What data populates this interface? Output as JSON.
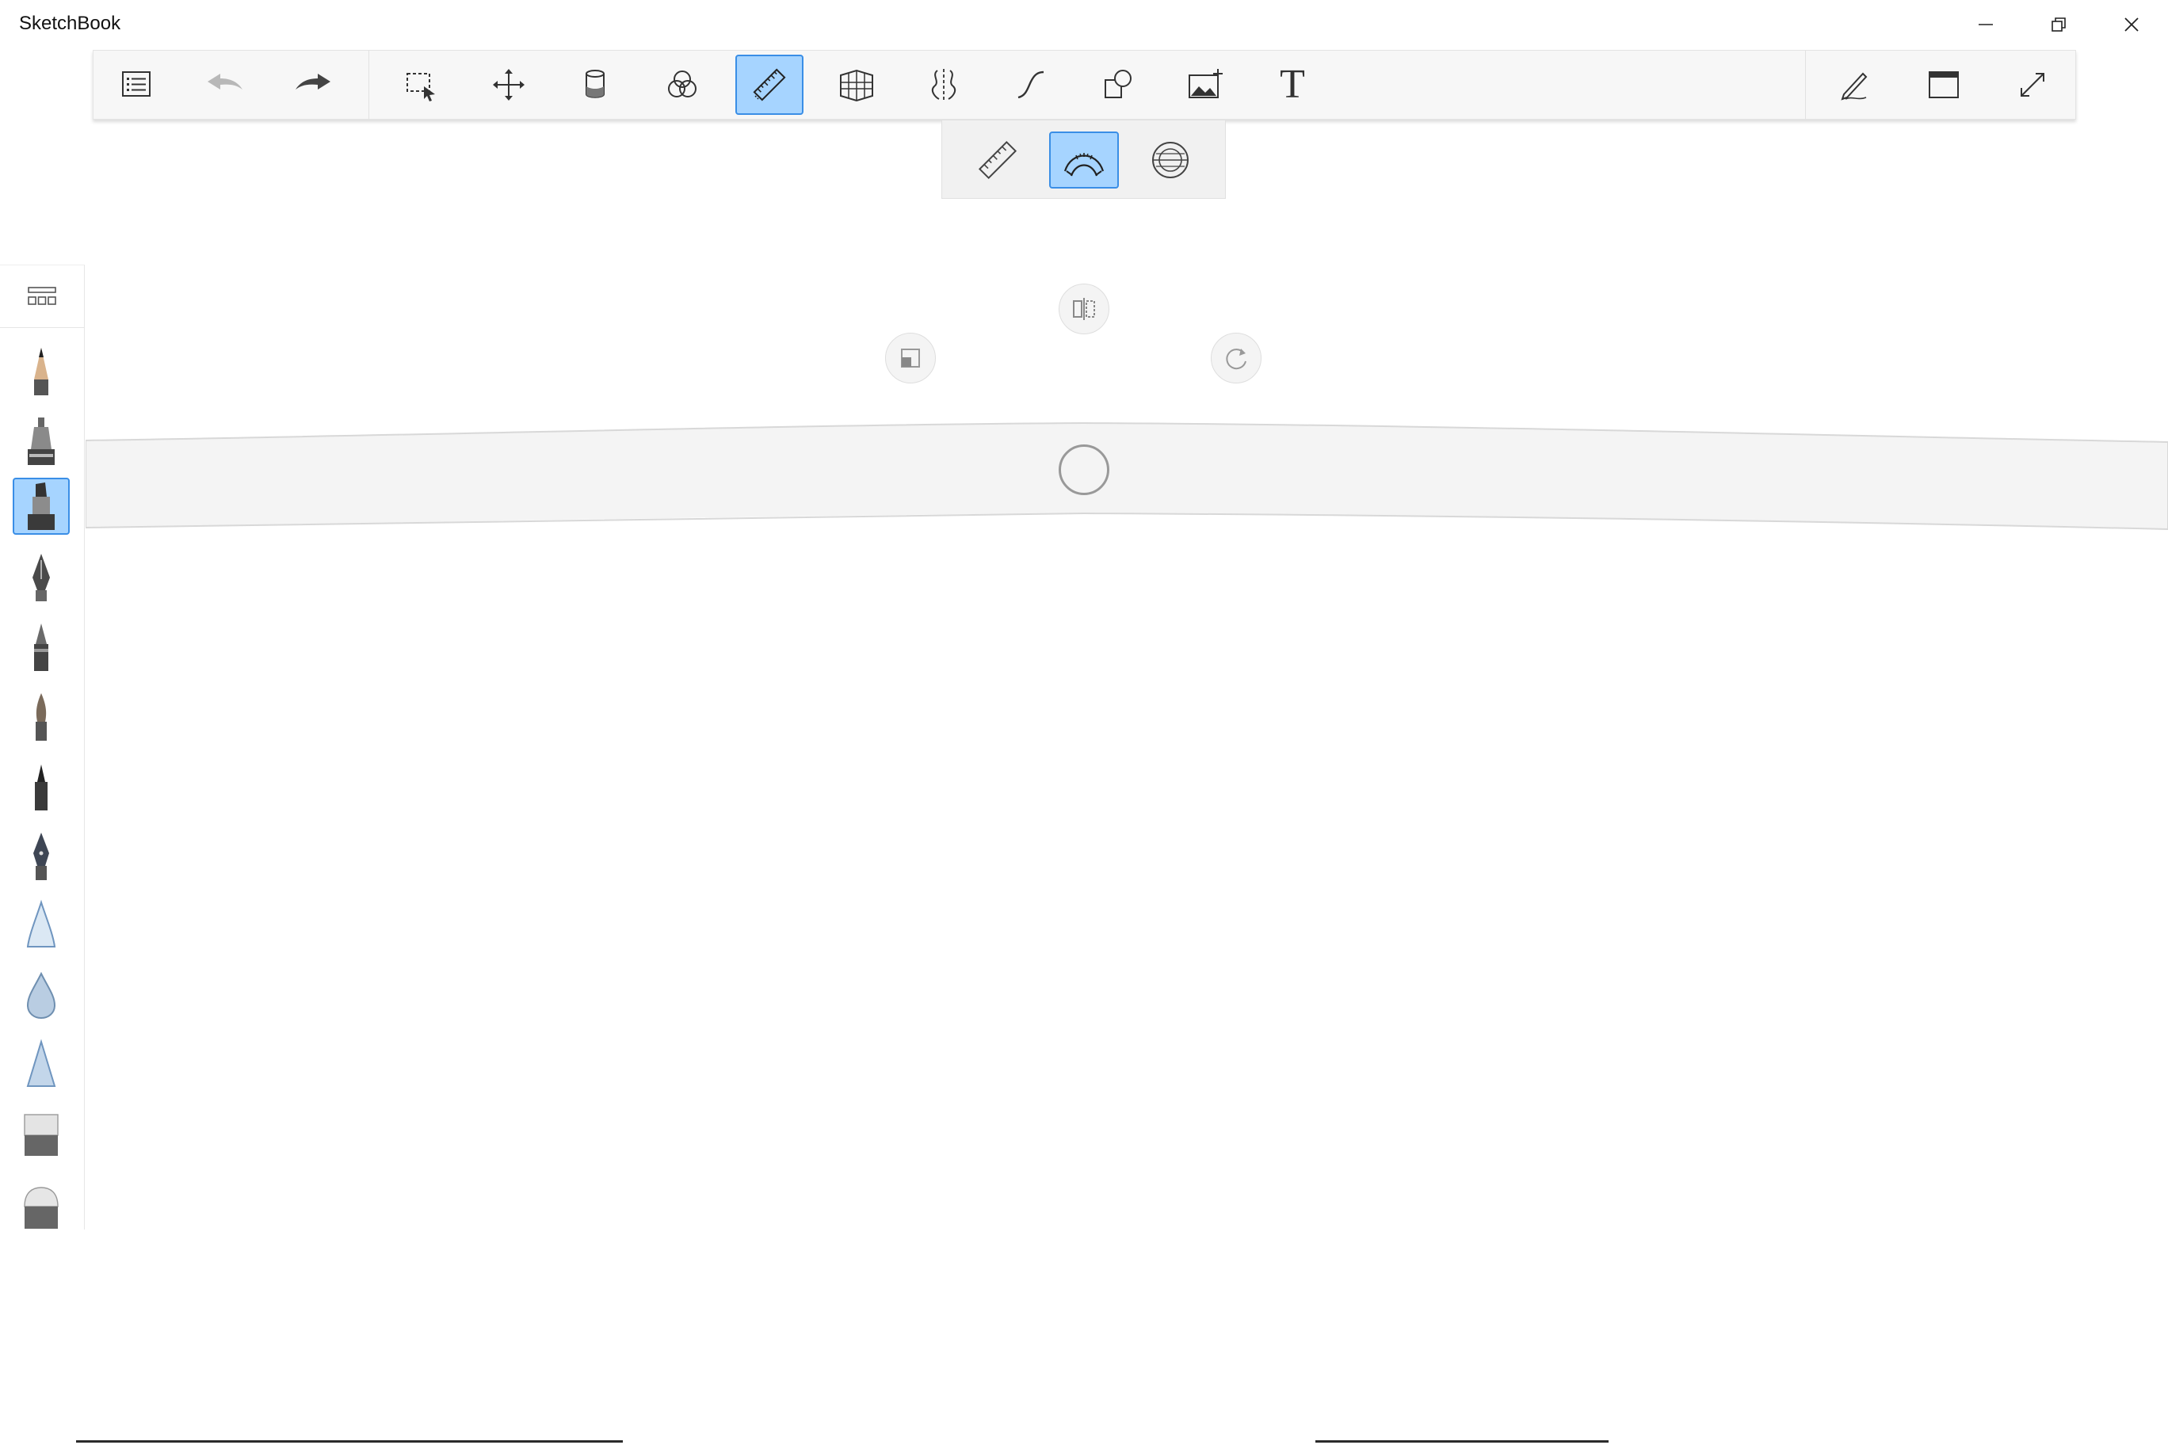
{
  "window": {
    "title": "SketchBook",
    "controls": [
      "minimize-icon",
      "restore-icon",
      "close-icon"
    ]
  },
  "toolbar": {
    "left_tools": [
      "list-icon",
      "undo-icon",
      "redo-icon"
    ],
    "center_tools": [
      "selection-icon",
      "transform-move-icon",
      "fill-bucket-icon",
      "color-circles-icon",
      "ruler-icon",
      "perspective-grid-icon",
      "symmetry-icon",
      "stroke-curve-icon",
      "shapes-icon",
      "add-image-icon",
      "text-icon"
    ],
    "text_tool_label": "T",
    "active_tool": "ruler",
    "right_tools": [
      "pen-settings-icon",
      "window-layout-icon",
      "fullscreen-icon"
    ]
  },
  "ruler_tools": {
    "options": [
      "straight-ruler-icon",
      "french-curve-icon",
      "ellipse-guide-icon"
    ],
    "active": "french-curve"
  },
  "brush_palette": {
    "header_icon": "grid-view-icon",
    "brushes": [
      "pencil-icon",
      "airbrush-icon",
      "marker-icon",
      "ink-pen-icon",
      "ballpoint-icon",
      "paintbrush-icon",
      "felt-pen-icon",
      "fountain-pen-icon",
      "smudge-cone-icon",
      "blur-drop-icon",
      "sharpen-cone-icon",
      "hard-eraser-icon",
      "soft-eraser-icon"
    ],
    "active_brush": "marker"
  },
  "canvas": {
    "guide": "french-curve",
    "handles": [
      "flip-guide-icon",
      "scale-guide-icon",
      "rotate-guide-icon",
      "center-pivot-icon"
    ]
  },
  "colors": {
    "accent": "#a6d4ff",
    "accent_border": "#3a8ee6",
    "toolbar_bg": "#f7f7f7",
    "icon": "#333333"
  }
}
